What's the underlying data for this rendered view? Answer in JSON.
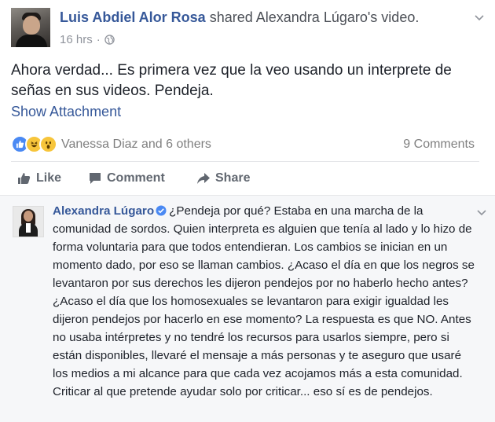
{
  "post": {
    "author": "Luis Abdiel Alor Rosa",
    "shared_text": "shared",
    "shared_owner": "Alexandra Lúgaro's video.",
    "time": "16 hrs",
    "time_separator": "·",
    "text": "Ahora verdad... Es primera vez que la veo usando un interprete de señas en sus videos. Pendeja.",
    "show_attachment": "Show Attachment",
    "reactions": [
      "like",
      "haha",
      "wow"
    ],
    "reactors": "Vanessa Diaz and 6 others",
    "comments_count": "9 Comments"
  },
  "actions": {
    "like": "Like",
    "comment": "Comment",
    "share": "Share"
  },
  "comment": {
    "author": "Alexandra Lúgaro",
    "text": "¿Pendeja por qué? Estaba en una marcha de la comunidad de sordos. Quien interpreta es alguien que tenía al lado y lo hizo de forma voluntaria para que todos entendieran. Los cambios se inician en un momento dado, por eso se llaman cambios. ¿Acaso el día en que los negros se levantaron por sus derechos les dijeron pendejos por no haberlo hecho antes? ¿Acaso el día que los homosexuales se levantaron para exigir igualdad les dijeron pendejos por hacerlo en ese momento? La respuesta es que NO. Antes no usaba intérpretes y no tendré los recursos para usarlos siempre, pero si están disponibles, llevaré el mensaje a más personas y te aseguro que usaré los medios a mi alcance para que cada vez acojamos más a esta comunidad. Criticar al que pretende ayudar solo por criticar... eso sí es de pendejos."
  },
  "colors": {
    "link": "#365899",
    "text": "#1d2129",
    "muted": "#90949c",
    "like_blue": "#4a89f3",
    "emoji_yellow": "#f7c53b",
    "comment_bg": "#f6f7f9"
  }
}
